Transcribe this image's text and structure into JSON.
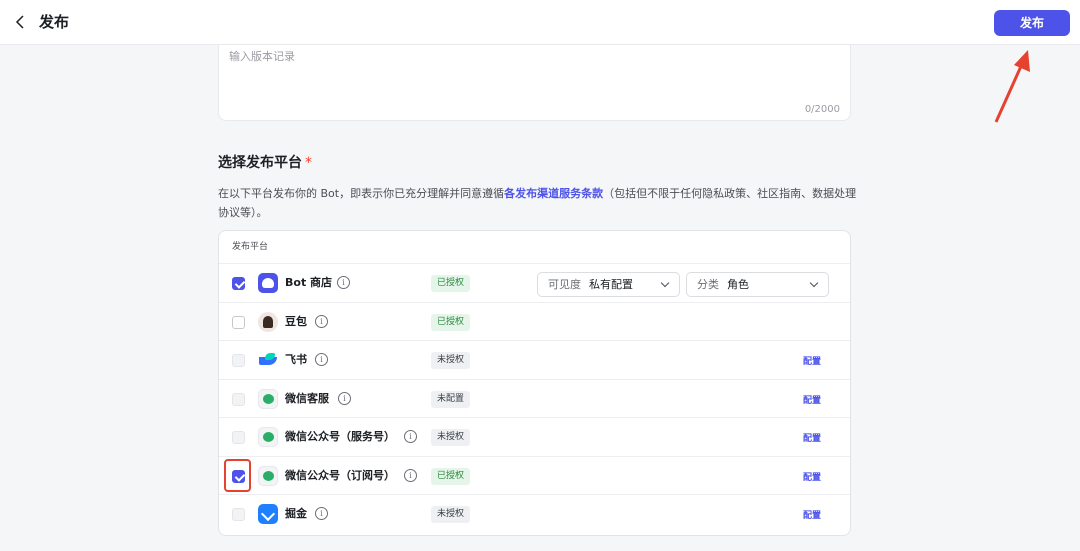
{
  "header": {
    "title": "发布",
    "publish_label": "发布"
  },
  "notes": {
    "placeholder": "输入版本记录",
    "count": "0/2000"
  },
  "section": {
    "title": "选择发布平台",
    "required_mark": "*",
    "desc_before": "在以下平台发布你的 Bot，即表示你已充分理解并同意遵循",
    "desc_link": "各发布渠道服务条款",
    "desc_after": "（包括但不限于任何隐私政策、社区指南、数据处理协议等）。"
  },
  "table": {
    "header": "发布平台",
    "rows": [
      {
        "name": "Bot 商店",
        "icon": "bot-store-icon",
        "status": "已授权",
        "checked": true
      },
      {
        "name": "豆包",
        "icon": "doubao-icon",
        "status": "已授权",
        "checked": false
      },
      {
        "name": "飞书",
        "icon": "feishu-icon",
        "status": "未授权",
        "action": "配置",
        "disabled": true
      },
      {
        "name": "微信客服",
        "icon": "wechat-icon",
        "status": "未配置",
        "action": "配置",
        "disabled": true
      },
      {
        "name": "微信公众号（服务号）",
        "icon": "wechat-icon",
        "status": "未授权",
        "action": "配置",
        "disabled": true
      },
      {
        "name": "微信公众号（订阅号）",
        "icon": "wechat-icon",
        "status": "已授权",
        "action": "配置",
        "checked": true
      },
      {
        "name": "掘金",
        "icon": "juejin-icon",
        "status": "未授权",
        "action": "配置",
        "disabled": true
      }
    ],
    "visibility": {
      "label": "可见度",
      "value": "私有配置"
    },
    "category": {
      "label": "分类",
      "value": "角色"
    }
  },
  "colors": {
    "accent": "#4d53e8",
    "annotation": "#e5422f",
    "authorized": "#2b8a3e"
  }
}
